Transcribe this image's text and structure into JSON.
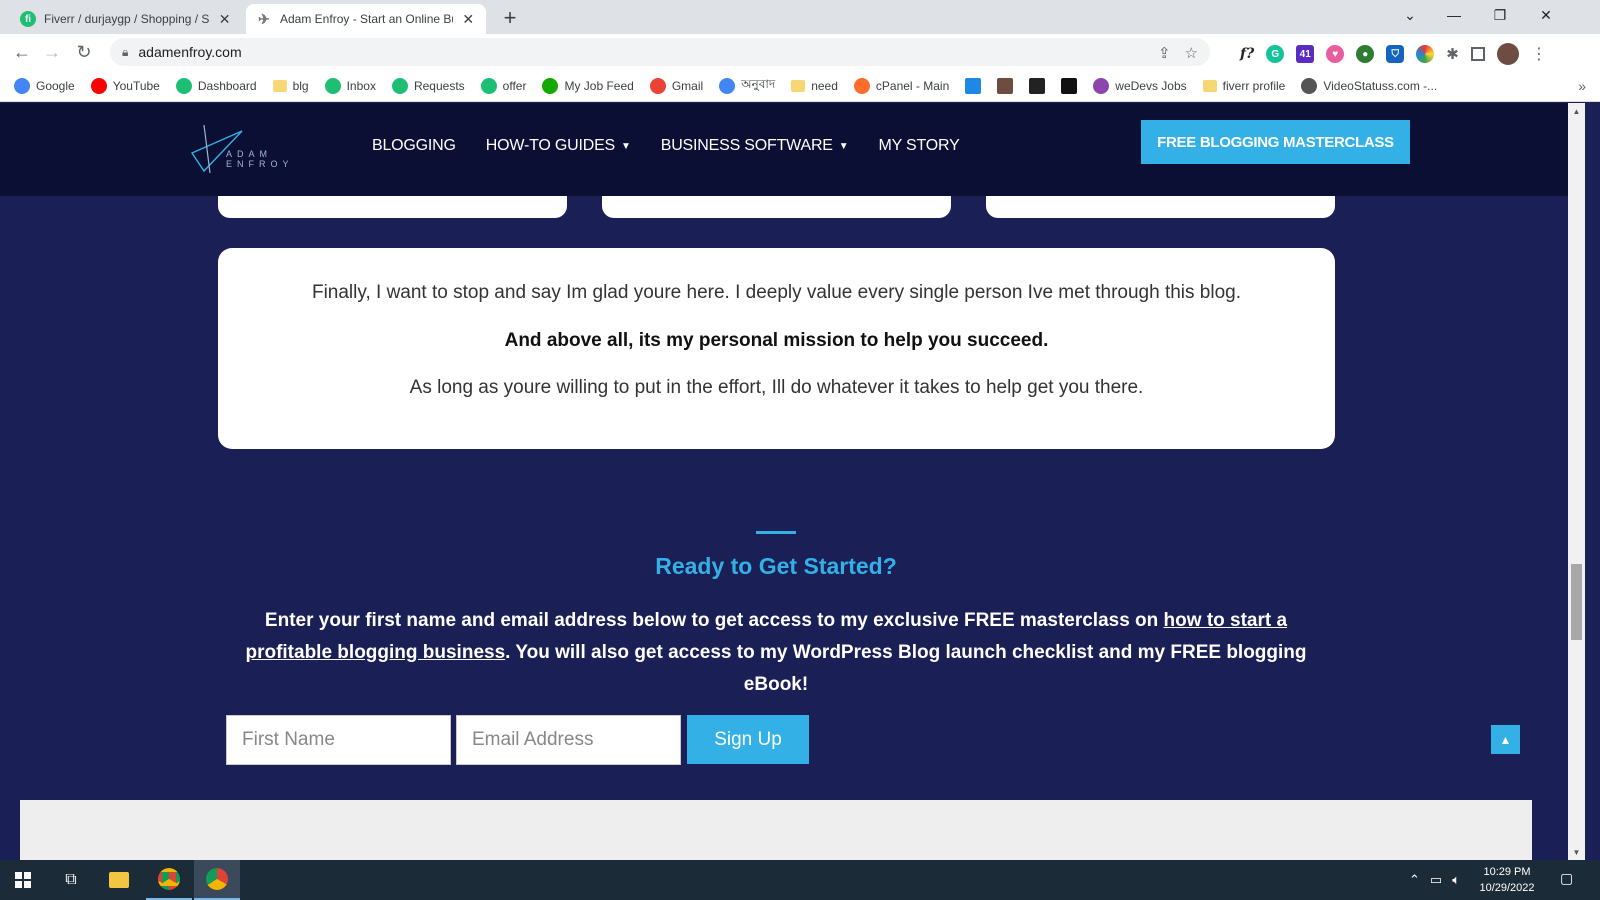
{
  "browser": {
    "tabs": [
      {
        "title": "Fiverr / durjaygp / Shopping / Sta",
        "favicon": "fiverr-icon",
        "active": false
      },
      {
        "title": "Adam Enfroy - Start an Online Bu",
        "favicon": "adam-enfroy-icon",
        "active": true
      }
    ],
    "new_tab": "+",
    "address": "adamenfroy.com",
    "window_controls": {
      "dropdown": "⌄",
      "minimize": "—",
      "restore": "❐",
      "close": "✕"
    },
    "bookmarks": [
      {
        "label": "Google",
        "icon": "google-icon",
        "color": "#4285f4"
      },
      {
        "label": "YouTube",
        "icon": "youtube-icon",
        "color": "#ff0000"
      },
      {
        "label": "Dashboard",
        "icon": "fiverr-icon",
        "color": "#1dbf73"
      },
      {
        "label": "blg",
        "icon": "folder-icon",
        "color": "#f7d774"
      },
      {
        "label": "Inbox",
        "icon": "fiverr-icon",
        "color": "#1dbf73"
      },
      {
        "label": "Requests",
        "icon": "fiverr-icon",
        "color": "#1dbf73"
      },
      {
        "label": "offer",
        "icon": "fiverr-icon",
        "color": "#1dbf73"
      },
      {
        "label": "My Job Feed",
        "icon": "upwork-icon",
        "color": "#14a800"
      },
      {
        "label": "Gmail",
        "icon": "gmail-icon",
        "color": "#ea4335"
      },
      {
        "label": "অনুবাদ",
        "icon": "translate-icon",
        "color": "#4285f4"
      },
      {
        "label": "need",
        "icon": "folder-icon",
        "color": "#f7d774"
      },
      {
        "label": "cPanel - Main",
        "icon": "cpanel-icon",
        "color": "#ff6c2c"
      },
      {
        "label": "",
        "icon": "bookmark-icon-1",
        "color": "#1e88e5"
      },
      {
        "label": "",
        "icon": "bookmark-icon-2",
        "color": "#6d4c41"
      },
      {
        "label": "",
        "icon": "bookmark-icon-3",
        "color": "#222222"
      },
      {
        "label": "",
        "icon": "bookmark-icon-4",
        "color": "#111111"
      },
      {
        "label": "weDevs Jobs",
        "icon": "wedevs-icon",
        "color": "#8e44ad"
      },
      {
        "label": "fiverr profile",
        "icon": "folder-icon",
        "color": "#f7d774"
      },
      {
        "label": "VideoStatuss.com -...",
        "icon": "globe-icon",
        "color": "#555555"
      }
    ],
    "bookmarks_more": "»"
  },
  "site": {
    "logo_text_line1": "ADAM",
    "logo_text_line2": "ENFROY",
    "nav": [
      {
        "label": "BLOGGING",
        "dropdown": false
      },
      {
        "label": "HOW-TO GUIDES",
        "dropdown": true
      },
      {
        "label": "BUSINESS SOFTWARE",
        "dropdown": true
      },
      {
        "label": "MY STORY",
        "dropdown": false
      }
    ],
    "header_cta": "FREE BLOGGING MASTERCLASS",
    "message": {
      "line1": "Finally, I want to stop and say Im glad youre here. I deeply value every single person Ive met through this blog.",
      "line2": "And above all, its my personal mission to help you succeed.",
      "line3": "As long as youre willing to put in the effort, Ill do whatever it takes to help get you there."
    },
    "signup_section": {
      "title": "Ready to Get Started?",
      "body_before": "Enter your first name and email address below to get access to my exclusive FREE masterclass on ",
      "body_link": "how to start a profitable blogging business",
      "body_after": ". You will also get access to my WordPress Blog launch checklist and my FREE blogging eBook!",
      "first_name_placeholder": "First Name",
      "email_placeholder": "Email Address",
      "button": "Sign Up"
    },
    "colors": {
      "accent": "#33b1e6",
      "header_bg": "#0a0f33",
      "page_bg": "#1a1f56"
    }
  },
  "taskbar": {
    "time": "10:29 PM",
    "date": "10/29/2022"
  }
}
